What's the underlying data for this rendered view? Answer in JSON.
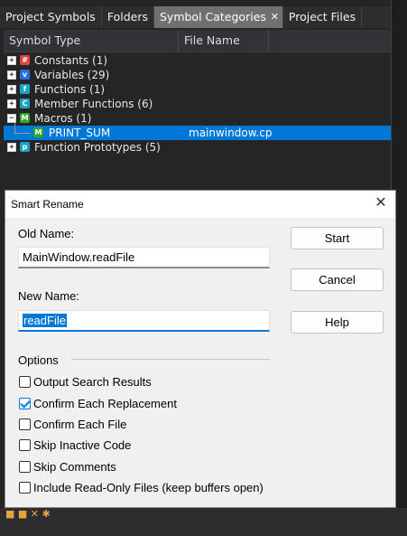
{
  "tabs": [
    {
      "label": "Project Symbols",
      "active": false
    },
    {
      "label": "Folders",
      "active": false
    },
    {
      "label": "Symbol Categories",
      "active": true
    },
    {
      "label": "Project Files",
      "active": false
    }
  ],
  "columns": {
    "symbol_type": "Symbol Type",
    "file_name": "File Name"
  },
  "tree": [
    {
      "label": "Constants (1)",
      "icon": "constant-icon",
      "color": "#e04040"
    },
    {
      "label": "Variables (29)",
      "icon": "variable-icon",
      "color": "#2a6fdb"
    },
    {
      "label": "Functions (1)",
      "icon": "function-icon",
      "color": "#1aa3c8"
    },
    {
      "label": "Member Functions (6)",
      "icon": "member-function-icon",
      "color": "#1aa3c8"
    },
    {
      "label": "Macros (1)",
      "icon": "macro-icon",
      "color": "#2fa82f"
    },
    {
      "label": "PRINT_SUM",
      "file": "mainwindow.cp",
      "icon": "macro-icon",
      "color": "#2fa82f"
    },
    {
      "label": "Function Prototypes (5)",
      "icon": "prototype-icon",
      "color": "#1aa3c8"
    }
  ],
  "dialog": {
    "title": "Smart Rename",
    "old_name_label": "Old Name:",
    "old_name_value": "MainWindow.readFile",
    "new_name_label": "New Name:",
    "new_name_value": "readFile",
    "buttons": {
      "start": "Start",
      "cancel": "Cancel",
      "help": "Help"
    },
    "options_label": "Options",
    "options": [
      {
        "label": "Output Search Results",
        "checked": false
      },
      {
        "label": "Confirm Each Replacement",
        "checked": true
      },
      {
        "label": "Confirm Each File",
        "checked": false
      },
      {
        "label": "Skip Inactive Code",
        "checked": false
      },
      {
        "label": "Skip Comments",
        "checked": false
      },
      {
        "label": "Include Read-Only Files (keep buffers open)",
        "checked": false
      }
    ]
  },
  "colors": {
    "accent": "#0078d7",
    "ide_background": "#252526"
  }
}
